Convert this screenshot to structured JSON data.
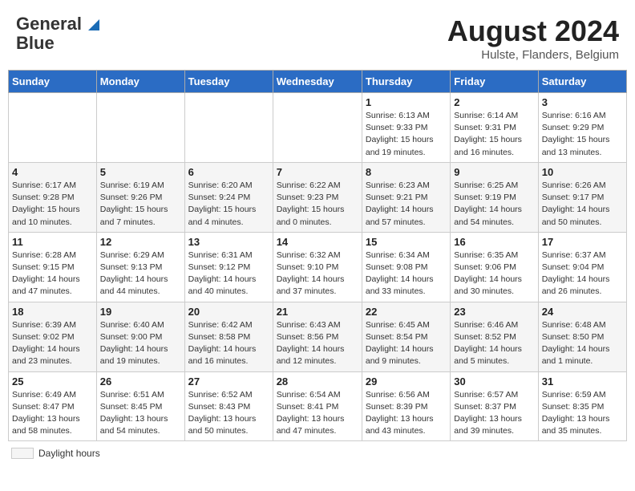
{
  "header": {
    "logo_line1": "General",
    "logo_line2": "Blue",
    "title": "August 2024",
    "subtitle": "Hulste, Flanders, Belgium"
  },
  "calendar": {
    "days_of_week": [
      "Sunday",
      "Monday",
      "Tuesday",
      "Wednesday",
      "Thursday",
      "Friday",
      "Saturday"
    ],
    "weeks": [
      [
        {
          "day": "",
          "info": ""
        },
        {
          "day": "",
          "info": ""
        },
        {
          "day": "",
          "info": ""
        },
        {
          "day": "",
          "info": ""
        },
        {
          "day": "1",
          "info": "Sunrise: 6:13 AM\nSunset: 9:33 PM\nDaylight: 15 hours\nand 19 minutes."
        },
        {
          "day": "2",
          "info": "Sunrise: 6:14 AM\nSunset: 9:31 PM\nDaylight: 15 hours\nand 16 minutes."
        },
        {
          "day": "3",
          "info": "Sunrise: 6:16 AM\nSunset: 9:29 PM\nDaylight: 15 hours\nand 13 minutes."
        }
      ],
      [
        {
          "day": "4",
          "info": "Sunrise: 6:17 AM\nSunset: 9:28 PM\nDaylight: 15 hours\nand 10 minutes."
        },
        {
          "day": "5",
          "info": "Sunrise: 6:19 AM\nSunset: 9:26 PM\nDaylight: 15 hours\nand 7 minutes."
        },
        {
          "day": "6",
          "info": "Sunrise: 6:20 AM\nSunset: 9:24 PM\nDaylight: 15 hours\nand 4 minutes."
        },
        {
          "day": "7",
          "info": "Sunrise: 6:22 AM\nSunset: 9:23 PM\nDaylight: 15 hours\nand 0 minutes."
        },
        {
          "day": "8",
          "info": "Sunrise: 6:23 AM\nSunset: 9:21 PM\nDaylight: 14 hours\nand 57 minutes."
        },
        {
          "day": "9",
          "info": "Sunrise: 6:25 AM\nSunset: 9:19 PM\nDaylight: 14 hours\nand 54 minutes."
        },
        {
          "day": "10",
          "info": "Sunrise: 6:26 AM\nSunset: 9:17 PM\nDaylight: 14 hours\nand 50 minutes."
        }
      ],
      [
        {
          "day": "11",
          "info": "Sunrise: 6:28 AM\nSunset: 9:15 PM\nDaylight: 14 hours\nand 47 minutes."
        },
        {
          "day": "12",
          "info": "Sunrise: 6:29 AM\nSunset: 9:13 PM\nDaylight: 14 hours\nand 44 minutes."
        },
        {
          "day": "13",
          "info": "Sunrise: 6:31 AM\nSunset: 9:12 PM\nDaylight: 14 hours\nand 40 minutes."
        },
        {
          "day": "14",
          "info": "Sunrise: 6:32 AM\nSunset: 9:10 PM\nDaylight: 14 hours\nand 37 minutes."
        },
        {
          "day": "15",
          "info": "Sunrise: 6:34 AM\nSunset: 9:08 PM\nDaylight: 14 hours\nand 33 minutes."
        },
        {
          "day": "16",
          "info": "Sunrise: 6:35 AM\nSunset: 9:06 PM\nDaylight: 14 hours\nand 30 minutes."
        },
        {
          "day": "17",
          "info": "Sunrise: 6:37 AM\nSunset: 9:04 PM\nDaylight: 14 hours\nand 26 minutes."
        }
      ],
      [
        {
          "day": "18",
          "info": "Sunrise: 6:39 AM\nSunset: 9:02 PM\nDaylight: 14 hours\nand 23 minutes."
        },
        {
          "day": "19",
          "info": "Sunrise: 6:40 AM\nSunset: 9:00 PM\nDaylight: 14 hours\nand 19 minutes."
        },
        {
          "day": "20",
          "info": "Sunrise: 6:42 AM\nSunset: 8:58 PM\nDaylight: 14 hours\nand 16 minutes."
        },
        {
          "day": "21",
          "info": "Sunrise: 6:43 AM\nSunset: 8:56 PM\nDaylight: 14 hours\nand 12 minutes."
        },
        {
          "day": "22",
          "info": "Sunrise: 6:45 AM\nSunset: 8:54 PM\nDaylight: 14 hours\nand 9 minutes."
        },
        {
          "day": "23",
          "info": "Sunrise: 6:46 AM\nSunset: 8:52 PM\nDaylight: 14 hours\nand 5 minutes."
        },
        {
          "day": "24",
          "info": "Sunrise: 6:48 AM\nSunset: 8:50 PM\nDaylight: 14 hours\nand 1 minute."
        }
      ],
      [
        {
          "day": "25",
          "info": "Sunrise: 6:49 AM\nSunset: 8:47 PM\nDaylight: 13 hours\nand 58 minutes."
        },
        {
          "day": "26",
          "info": "Sunrise: 6:51 AM\nSunset: 8:45 PM\nDaylight: 13 hours\nand 54 minutes."
        },
        {
          "day": "27",
          "info": "Sunrise: 6:52 AM\nSunset: 8:43 PM\nDaylight: 13 hours\nand 50 minutes."
        },
        {
          "day": "28",
          "info": "Sunrise: 6:54 AM\nSunset: 8:41 PM\nDaylight: 13 hours\nand 47 minutes."
        },
        {
          "day": "29",
          "info": "Sunrise: 6:56 AM\nSunset: 8:39 PM\nDaylight: 13 hours\nand 43 minutes."
        },
        {
          "day": "30",
          "info": "Sunrise: 6:57 AM\nSunset: 8:37 PM\nDaylight: 13 hours\nand 39 minutes."
        },
        {
          "day": "31",
          "info": "Sunrise: 6:59 AM\nSunset: 8:35 PM\nDaylight: 13 hours\nand 35 minutes."
        }
      ]
    ]
  },
  "footer": {
    "label": "Daylight hours"
  }
}
